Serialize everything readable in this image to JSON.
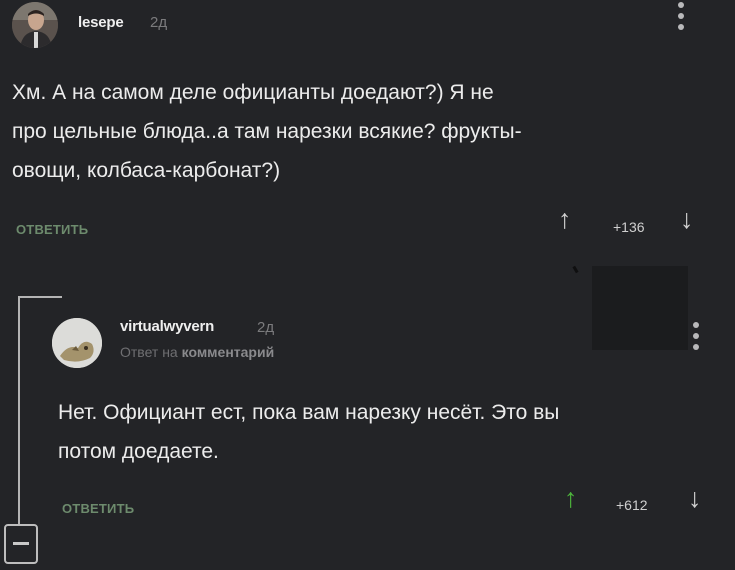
{
  "colors": {
    "background": "#232427",
    "reply_link": "#6d8b6d",
    "upvote_active": "#4db53c",
    "arrow_neutral": "#cfcfcf"
  },
  "comment1": {
    "author": "lesepe",
    "time": "2д",
    "lines": [
      "Хм. А на самом деле официанты доедают?) Я не",
      "про цельные блюда..а там нарезки всякие? фрукты-",
      "овощи, колбаса-карбонат?)"
    ],
    "reply_label": "ОТВЕТИТЬ",
    "score": "+136",
    "upvote_icon": "arrow-up-icon",
    "downvote_icon": "arrow-down-icon"
  },
  "comment2": {
    "author": "virtualwyvern",
    "time": "2д",
    "sub_prefix": "Ответ на",
    "sub_link": "комментарий",
    "lines": [
      "Нет. Официант ест, пока вам нарезку несёт. Это вы",
      "потом доедаете."
    ],
    "reply_label": "ОТВЕТИТЬ",
    "score": "+612",
    "upvote_icon": "arrow-up-icon",
    "downvote_icon": "arrow-down-icon"
  }
}
